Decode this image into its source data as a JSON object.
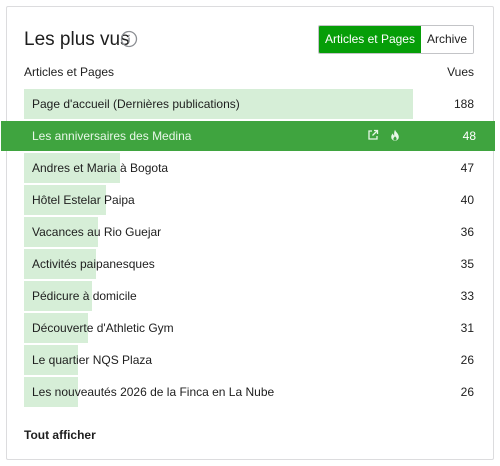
{
  "header": {
    "title": "Les plus vus",
    "toggle": [
      "Articles et Pages",
      "Archive"
    ]
  },
  "columns": {
    "left": "Articles et Pages",
    "right": "Vues"
  },
  "rows": [
    {
      "label": "Page d'accueil (Dernières publications)",
      "count": "188"
    },
    {
      "label": "Les anniversaires des Medina",
      "count": "48"
    },
    {
      "label": "Andres et Maria à Bogota",
      "count": "47"
    },
    {
      "label": "Hôtel Estelar Paipa",
      "count": "40"
    },
    {
      "label": "Vacances au Rio Guejar",
      "count": "36"
    },
    {
      "label": "Activités paipanesques",
      "count": "35"
    },
    {
      "label": "Pédicure à domicile",
      "count": "33"
    },
    {
      "label": "Découverte d'Athletic Gym",
      "count": "31"
    },
    {
      "label": "Le quartier NQS Plaza",
      "count": "26"
    },
    {
      "label": "Les nouveautés 2026 de la Finca en La Nube",
      "count": "26"
    }
  ],
  "footer": {
    "link": "Tout afficher"
  },
  "colors": {
    "accent": "#069e08",
    "bar": "#d6eed7",
    "highlight": "#3fa43f"
  }
}
